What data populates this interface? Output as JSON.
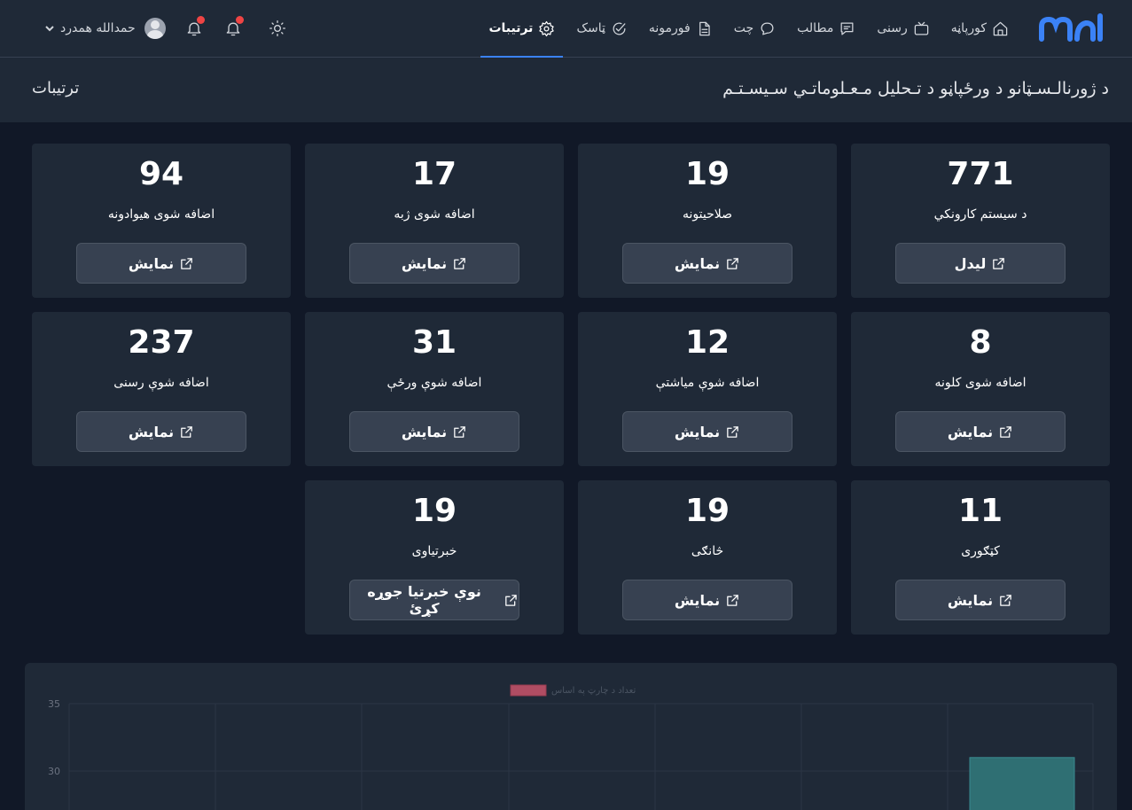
{
  "nav": {
    "logo_text": "ملی",
    "items": [
      {
        "label": "کورپاڼه",
        "icon": "home-icon",
        "active": false
      },
      {
        "label": "رسنی",
        "icon": "tv-icon",
        "active": false
      },
      {
        "label": "مطالب",
        "icon": "message-square-icon",
        "active": false
      },
      {
        "label": "چت",
        "icon": "chat-bubble-icon",
        "active": false
      },
      {
        "label": "فورمونه",
        "icon": "document-icon",
        "active": false
      },
      {
        "label": "ټاسک",
        "icon": "check-circle-icon",
        "active": false
      },
      {
        "label": "ترتیبات",
        "icon": "gear-icon",
        "active": true
      }
    ],
    "user_name": "حمدالله همدرد",
    "user_icon": "chevron-down-icon"
  },
  "header": {
    "title": "د ژورنالـسـټانو د ورځپاڼو د تـحلیل مـعـلوماتـي سـیسـتـم",
    "breadcrumb": "ترتیبات"
  },
  "cards": [
    {
      "value": "771",
      "label": "د سیستم کارونکي",
      "button": "لیدل"
    },
    {
      "value": "19",
      "label": "صلاحیتونه",
      "button": "نمایش"
    },
    {
      "value": "17",
      "label": "اضافه شوی ژبه",
      "button": "نمایش"
    },
    {
      "value": "94",
      "label": "اضافه شوی هیوادونه",
      "button": "نمایش"
    },
    {
      "value": "8",
      "label": "اضافه شوی کلونه",
      "button": "نمایش"
    },
    {
      "value": "12",
      "label": "اضافه شوې میاشتې",
      "button": "نمایش"
    },
    {
      "value": "31",
      "label": "اضافه شوې ورځې",
      "button": "نمایش"
    },
    {
      "value": "237",
      "label": "اضافه شوې رسنی",
      "button": "نمایش"
    },
    {
      "value": "11",
      "label": "کټګوری",
      "button": "نمایش"
    },
    {
      "value": "19",
      "label": "څانګی",
      "button": "نمایش"
    },
    {
      "value": "19",
      "label": "خبرتیاوی",
      "button": "نوې خبرتیا جوړه کړئ"
    }
  ],
  "colors": {
    "accent": "#3b82f6",
    "notification_dot": "#ef4444",
    "legend_swatch": "#e15a72",
    "bar_fill": "#2f6f73"
  },
  "chart_data": {
    "type": "bar",
    "legend": [
      "تعداد د چارټ په اساس"
    ],
    "legend_position": "top",
    "y_ticks": [
      35,
      30
    ],
    "ylim": [
      25,
      35
    ],
    "grid": true,
    "series": [
      {
        "name": "تعداد د چارټ په اساس",
        "values": [
          31
        ]
      }
    ]
  }
}
